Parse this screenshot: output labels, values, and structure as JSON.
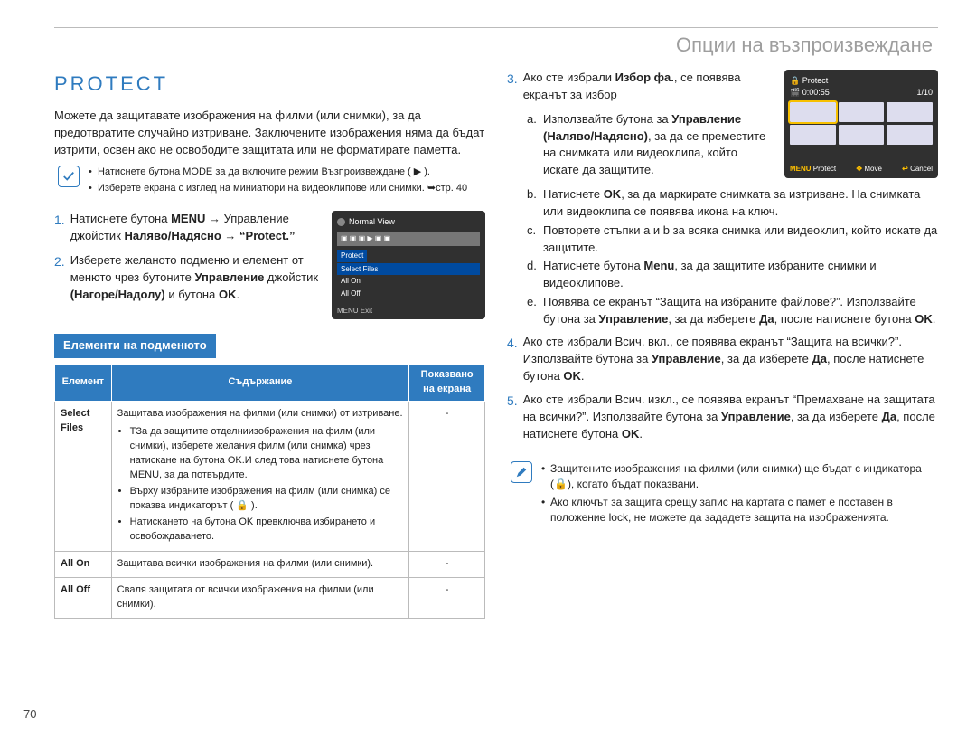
{
  "header": "Опции на възпроизвеждане",
  "protect_title": "PROTECT",
  "intro": "Можете да защитавате изображения на филми (или снимки), за да предотвратите случайно изтриване. Заключените изображения няма да бъдат изтрити, освен ако не освободите защитата или не форматирате паметта.",
  "top_notes": [
    "Натиснете бутона MODE за да включите режим Възпроизвеждане ( ▶ ).",
    "Изберете екрана с изглед на миниатюри на видеоклипове или снимки. ➥стр. 40"
  ],
  "steps_left": {
    "s1_a": "Натиснете бутона ",
    "s1_menu": "MENU",
    "s1_b": " → Управление джойстик ",
    "s1_dir": "Наляво/Надясно",
    "s1_c": " → ",
    "s1_protect": "“Protect.”",
    "s2_a": "Изберете желаното подменю и елемент от менюто чрез бутоните ",
    "s2_ctrl": "Управление",
    "s2_b": " джойстик ",
    "s2_dir": "(Нагоре/Надолу)",
    "s2_c": " и бутона ",
    "s2_ok": "OK",
    "s2_d": "."
  },
  "screen1": {
    "title": "Normal View",
    "protect": "Protect",
    "select": "Select Files",
    "allon": "All On",
    "alloff": "All Off",
    "exit": "MENU Exit"
  },
  "sub_title": "Елементи на подменюто",
  "table": {
    "h1": "Елемент",
    "h2": "Съдържание",
    "h3": "Показвано на екрана",
    "r1e": "Select Files",
    "r1c_intro": "Защитава изображения на филми (или снимки) от изтриване.",
    "r1c_b1": "TЗа да защитите отделниизображения на филм (или снимки), изберете желания филм (или снимка) чрез натискане на бутона OK.И след това натиснете бутона MENU, за да потвърдите.",
    "r1c_b2": "Върху избраните изображения на филм (или снимка) се показва индикаторът ( 🔒 ).",
    "r1c_b3": "Натискането на бутона OK превключва избирането и освобождаването.",
    "r1d": "-",
    "r2e": "All On",
    "r2c": "Защитава всички изображения на филми (или снимки).",
    "r2d": "-",
    "r3e": "All Off",
    "r3c": "Сваля защитата от всички изображения на филми (или снимки).",
    "r3d": "-"
  },
  "right": {
    "s3": {
      "intro_a": "Ако сте избрали ",
      "intro_b": "Избор фа.",
      "intro_c": ", се появява екранът за избор",
      "a_a": "Използвайте бутона за ",
      "a_b": "Управление (Наляво/Надясно)",
      "a_c": ", за да се преместите на снимката или видеоклипа, който искате да защитите.",
      "b_a": "Натиснете ",
      "b_b": "OK",
      "b_c": ", за да маркирате снимката за изтриване. На снимката или видеоклипа се появява икона на ключ.",
      "c": "Повторете стъпки a и b за всяка снимка или видеоклип, който искате да защитите.",
      "d_a": "Натиснете бутона ",
      "d_b": "Menu",
      "d_c": ", за да защитите избраните снимки и видеоклипове.",
      "e_a": "Появява се екранът “Защита на избраните файлове?”. Използвайте бутона за ",
      "e_b": "Управление",
      "e_c": ", за да изберете ",
      "e_d": "Да",
      "e_e": ", после натиснете бутона ",
      "e_f": "OK",
      "e_g": "."
    },
    "s4_a": "Ако сте избрали Всич. вкл., се появява екранът “Защита на всички?”. Използвайте бутона за ",
    "s4_b": "Управление",
    "s4_c": ", за да изберете ",
    "s4_d": "Да",
    "s4_e": ", после натиснете бутона ",
    "s4_f": "OK",
    "s4_g": ".",
    "s5_a": "Ако сте избрали Всич. изкл., се появява екранът “Премахване на защитата на всички?”. Използвайте бутона за ",
    "s5_b": "Управление",
    "s5_c": ", за да изберете ",
    "s5_d": "Да",
    "s5_e": ", после натиснете бутона ",
    "s5_f": "OK",
    "s5_g": "."
  },
  "screen2": {
    "title": "Protect",
    "time": "0:00:55",
    "count": "1/10",
    "foot_protect": "Protect",
    "foot_move": "Move",
    "foot_cancel": "Cancel"
  },
  "bottom_notes": [
    "Защитените изображения на филми (или снимки) ще бъдат с индикатора (🔒), когато бъдат показвани.",
    "Ако ключът за защита срещу запис на картата с памет е поставен в положение lock, не можете да зададете защита на изображенията."
  ],
  "page_number": "70"
}
